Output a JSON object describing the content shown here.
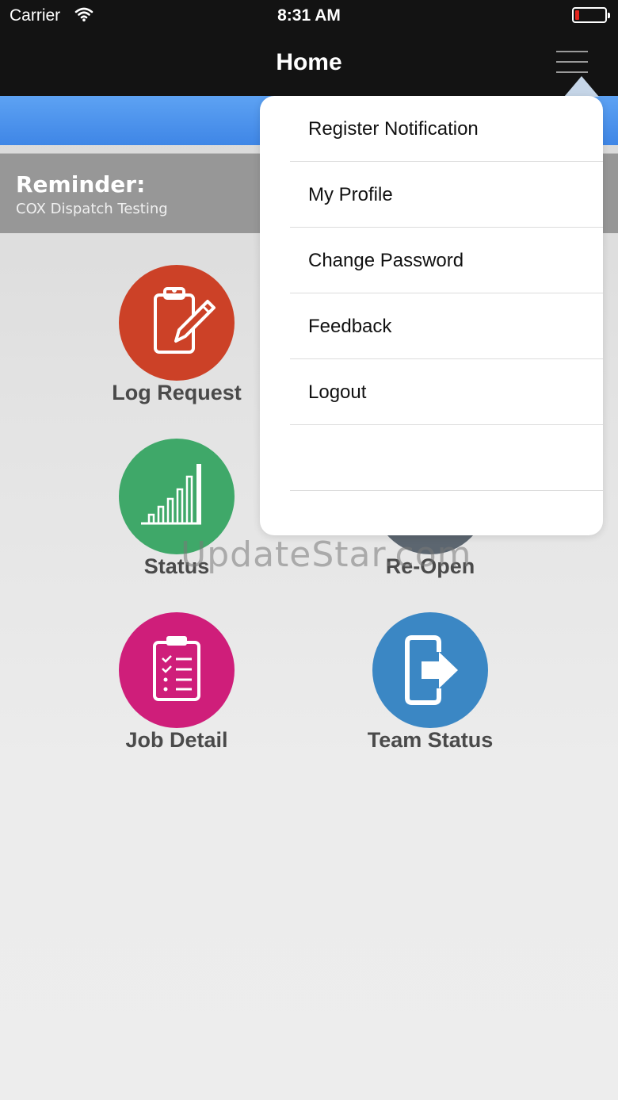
{
  "status_bar": {
    "carrier": "Carrier",
    "time": "8:31 AM"
  },
  "nav": {
    "title": "Home"
  },
  "reminder": {
    "title": "Reminder:",
    "text": "COX Dispatch Testing"
  },
  "tiles": [
    {
      "label": "Log Request",
      "color": "#cc4127",
      "icon": "clipboard-pencil-icon"
    },
    {
      "label": "Status",
      "color": "#3fa869",
      "icon": "bar-chart-icon"
    },
    {
      "label": "Re-Open",
      "color": "#5c6670",
      "icon": "reopen-icon"
    },
    {
      "label": "Job Detail",
      "color": "#cf1e7a",
      "icon": "checklist-icon"
    },
    {
      "label": "Team Status",
      "color": "#3b87c4",
      "icon": "exit-arrow-icon"
    }
  ],
  "menu": {
    "items": [
      {
        "label": "Register Notification"
      },
      {
        "label": "My Profile"
      },
      {
        "label": "Change Password"
      },
      {
        "label": "Feedback"
      },
      {
        "label": "Logout"
      },
      {
        "label": ""
      }
    ]
  },
  "watermark": "UpdateStar.com",
  "colors": {
    "nav_bg": "#131313",
    "band_blue": "#4a90e2",
    "reminder_bg": "#979797"
  }
}
